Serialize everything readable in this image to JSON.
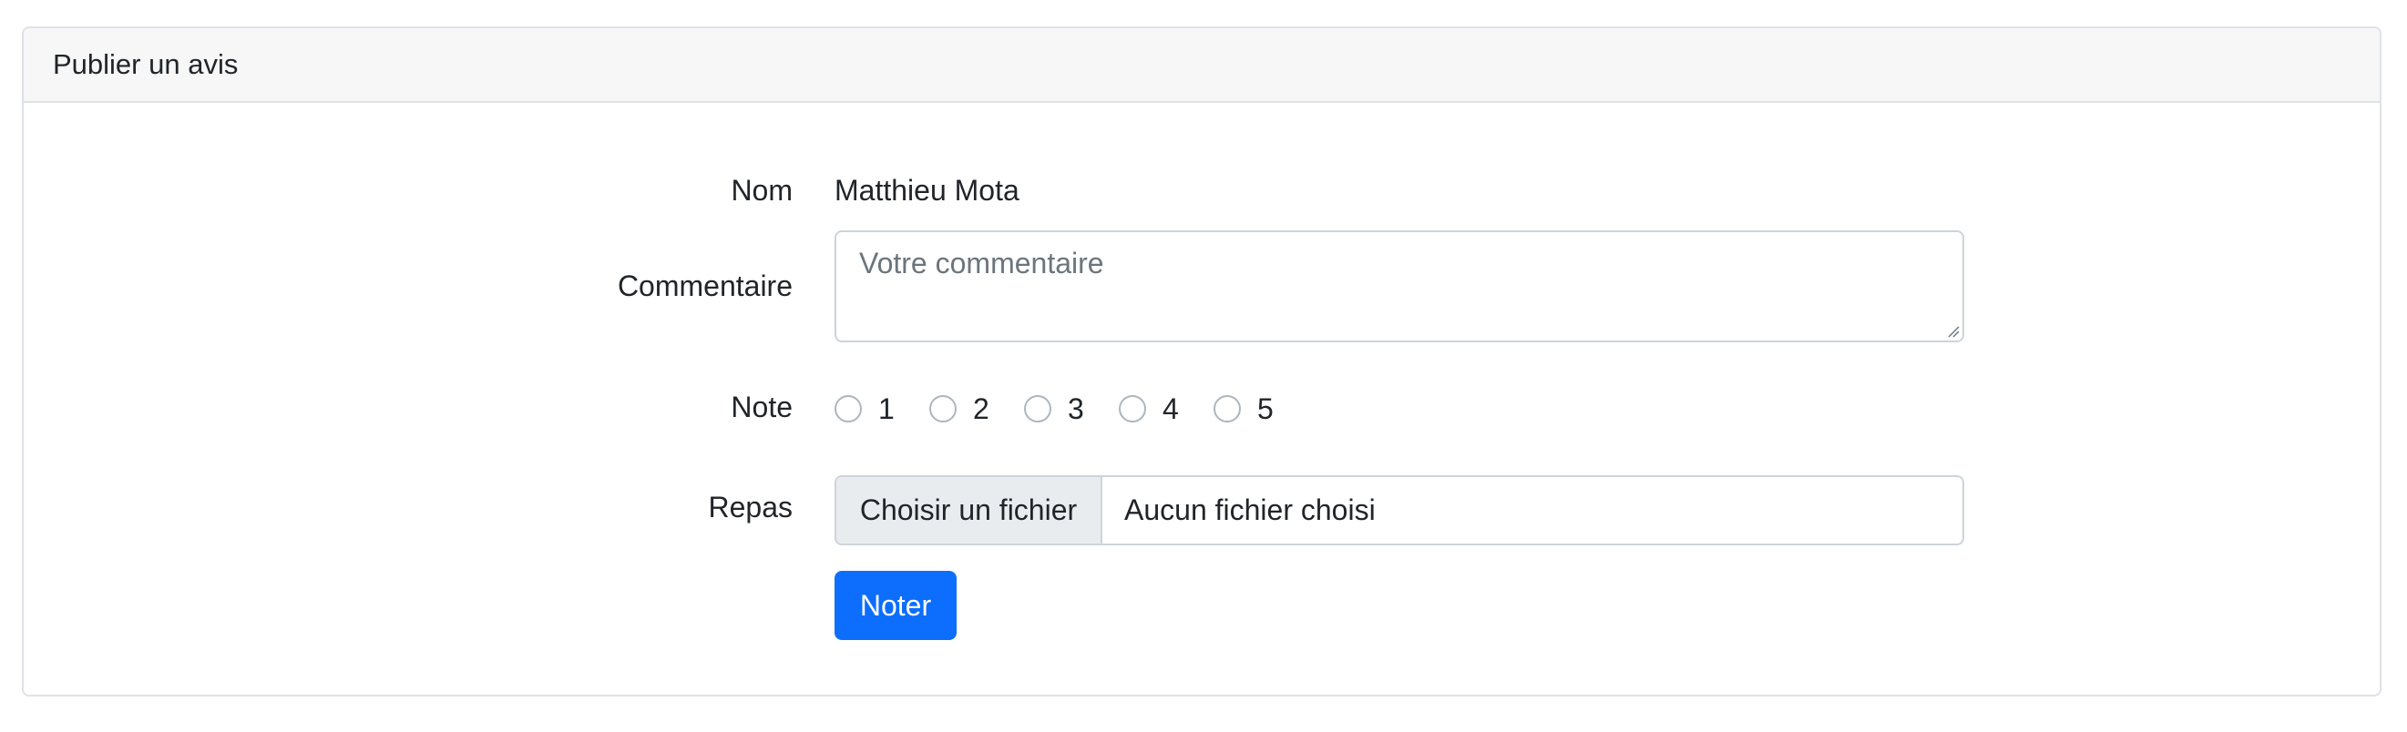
{
  "card": {
    "title": "Publier un avis"
  },
  "form": {
    "nom": {
      "label": "Nom",
      "value": "Matthieu Mota"
    },
    "commentaire": {
      "label": "Commentaire",
      "placeholder": "Votre commentaire",
      "value": ""
    },
    "note": {
      "label": "Note",
      "options": [
        "1",
        "2",
        "3",
        "4",
        "5"
      ],
      "selected": null
    },
    "repas": {
      "label": "Repas",
      "button_label": "Choisir un fichier",
      "file_status": "Aucun fichier choisi"
    },
    "submit_label": "Noter"
  },
  "colors": {
    "primary": "#0d6efd",
    "header_bg": "#f7f7f7",
    "border": "#dee2e6",
    "input_border": "#ced4da",
    "placeholder": "#6c757d",
    "file_button_bg": "#e9ecef"
  },
  "icons": {
    "textarea_resize": "resize-handle-icon"
  }
}
